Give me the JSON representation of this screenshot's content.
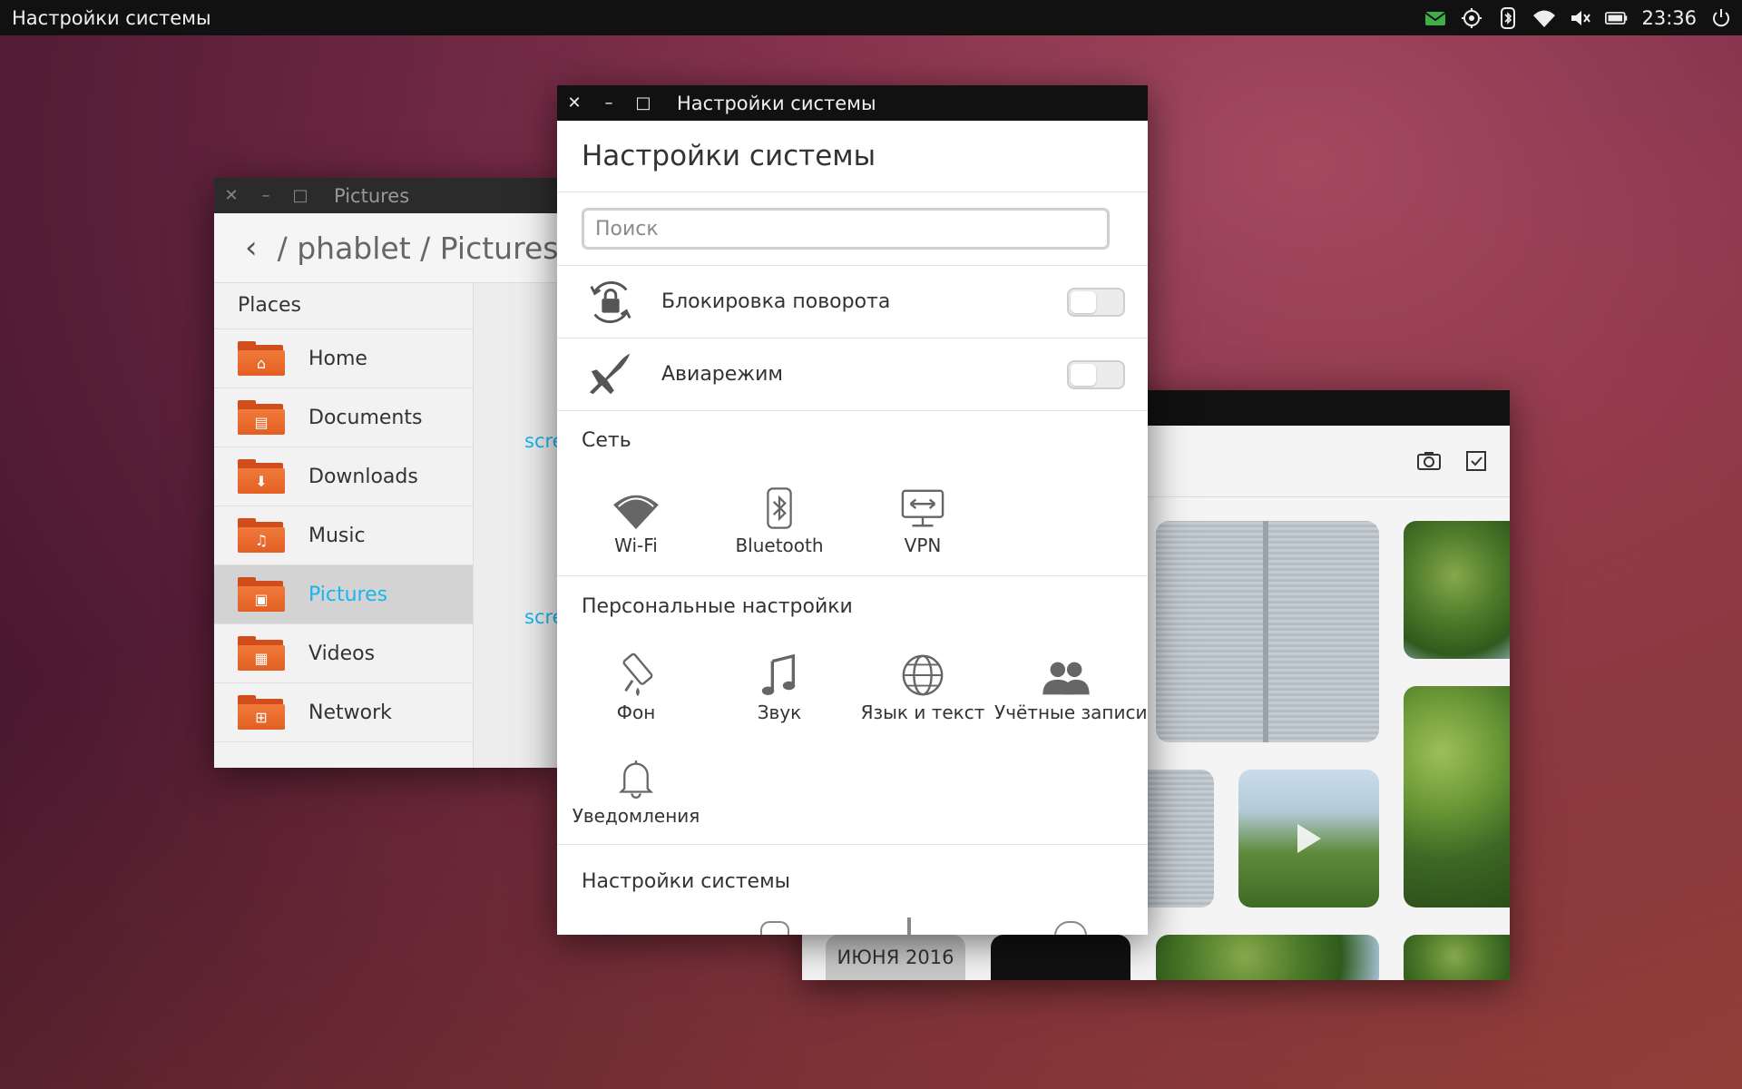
{
  "top_panel": {
    "app_title": "Настройки системы",
    "clock": "23:36",
    "indicators": [
      "mail-icon",
      "location-icon",
      "bluetooth-icon",
      "wifi-icon",
      "sound-muted-icon",
      "battery-icon",
      "power-icon"
    ],
    "mail_color": "#3fae49"
  },
  "files_window": {
    "title": "Pictures",
    "back_glyph": "‹",
    "path": "/ phablet / Pictures",
    "places_title": "Places",
    "places": [
      {
        "label": "Home",
        "icon": "home-folder-icon"
      },
      {
        "label": "Documents",
        "icon": "documents-folder-icon"
      },
      {
        "label": "Downloads",
        "icon": "downloads-folder-icon"
      },
      {
        "label": "Music",
        "icon": "music-folder-icon"
      },
      {
        "label": "Pictures",
        "icon": "pictures-folder-icon",
        "active": true
      },
      {
        "label": "Videos",
        "icon": "videos-folder-icon"
      },
      {
        "label": "Network",
        "icon": "network-folder-icon"
      }
    ],
    "content_links": [
      "scre",
      "scre"
    ],
    "accent": "#19b6ee"
  },
  "gallery_window": {
    "date_chip": "ИЮНЯ 2016",
    "toolbar_icons": [
      "camera-icon",
      "select-checkbox-icon"
    ]
  },
  "settings_window": {
    "title": "Настройки системы",
    "header_title": "Настройки системы",
    "search_placeholder": "Поиск",
    "toggles": [
      {
        "label": "Блокировка поворота",
        "icon": "rotation-lock-icon",
        "on": false
      },
      {
        "label": "Авиарежим",
        "icon": "airplane-icon",
        "on": false
      }
    ],
    "sections": {
      "network": {
        "title": "Сеть",
        "items": [
          {
            "label": "Wi-Fi",
            "icon": "wifi-icon"
          },
          {
            "label": "Bluetooth",
            "icon": "bluetooth-icon"
          },
          {
            "label": "VPN",
            "icon": "vpn-icon"
          }
        ]
      },
      "personal": {
        "title": "Персональные настройки",
        "items": [
          {
            "label": "Фон",
            "icon": "paint-roller-icon"
          },
          {
            "label": "Звук",
            "icon": "music-note-icon"
          },
          {
            "label": "Язык и текст",
            "icon": "globe-icon"
          },
          {
            "label": "Учётные записи",
            "icon": "users-icon"
          },
          {
            "label": "Уведомления",
            "icon": "bell-icon"
          }
        ]
      },
      "system": {
        "title": "Настройки системы"
      }
    }
  }
}
